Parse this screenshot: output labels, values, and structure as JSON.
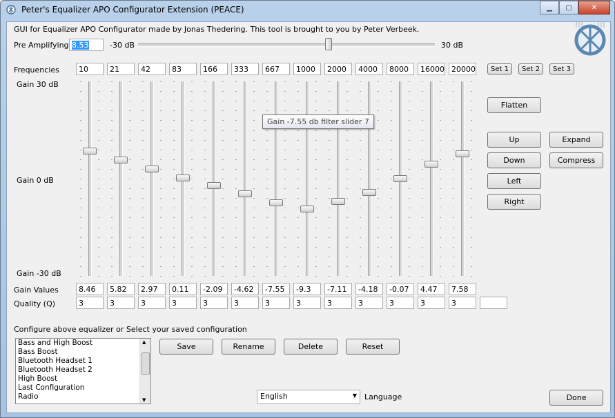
{
  "window": {
    "title": "Peter's Equalizer APO Configurator Extension (PEACE)"
  },
  "header": {
    "info": "GUI for Equalizer APO Configurator made by Jonas Thedering. This tool is brought to you by Peter Verbeek."
  },
  "preamp": {
    "label": "Pre Amplifying",
    "value": "8.53",
    "min_label": "-30 dB",
    "max_label": "30 dB",
    "level_db": 8.53
  },
  "freq_label": "Frequencies",
  "frequencies": [
    "10",
    "21",
    "42",
    "83",
    "166",
    "333",
    "667",
    "1000",
    "2000",
    "4000",
    "8000",
    "16000",
    "20000"
  ],
  "set_buttons": [
    "Set 1",
    "Set 2",
    "Set 3"
  ],
  "gain_axis": {
    "top": "Gain 30 dB",
    "mid": "Gain 0 dB",
    "bottom": "Gain -30 dB"
  },
  "gains_label": "Gain Values",
  "gains": [
    "8.46",
    "5.82",
    "2.97",
    "0.11",
    "-2.09",
    "-4.62",
    "-7.55",
    "-9.3",
    "-7.11",
    "-4.18",
    "-0.07",
    "4.47",
    "7.58"
  ],
  "gain_levels": [
    8.46,
    5.82,
    2.97,
    0.11,
    -2.09,
    -4.62,
    -7.55,
    -9.3,
    -7.11,
    -4.18,
    -0.07,
    4.47,
    7.58
  ],
  "quality_label": "Quality (Q)",
  "qualities": [
    "3",
    "3",
    "3",
    "3",
    "3",
    "3",
    "3",
    "3",
    "3",
    "3",
    "3",
    "3",
    "3",
    ""
  ],
  "tooltip": "Gain -7.55 db filter slider 7",
  "controls": {
    "flatten": "Flatten",
    "up": "Up",
    "down": "Down",
    "left": "Left",
    "right": "Right",
    "expand": "Expand",
    "compress": "Compress"
  },
  "config": {
    "label": "Configure above equalizer or Select your saved configuration",
    "items": [
      "Bass and High Boost",
      "Bass Boost",
      "Bluetooth Headset 1",
      "Bluetooth Headset 2",
      "High Boost",
      "Last Configuration",
      "Radio"
    ],
    "save": "Save",
    "rename": "Rename",
    "delete": "Delete",
    "reset": "Reset"
  },
  "language": {
    "value": "English",
    "label": "Language"
  },
  "done": "Done"
}
